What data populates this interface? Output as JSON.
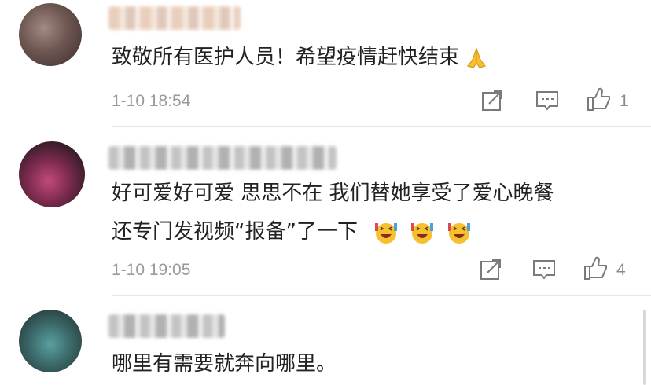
{
  "comments": [
    {
      "text": "致敬所有医护人员！希望疫情赶快结束",
      "time": "1-10 18:54",
      "likes": "1"
    },
    {
      "text_line1": "好可爱好可爱 思思不在 我们替她享受了爱心晚餐",
      "text_line2": "还专门发视频“报备”了一下",
      "time": "1-10 19:05",
      "likes": "4"
    },
    {
      "text": "哪里有需要就奔向哪里。"
    }
  ],
  "icons": {
    "share": "share-icon",
    "comment": "comment-icon",
    "like": "thumbs-up-icon",
    "pray": "praying-hands-emoji",
    "laugh": "laughing-emoji"
  },
  "colors": {
    "text": "#222222",
    "meta": "#9a9a9a",
    "divider": "#e6e6e6",
    "emoji": "#f6c12f"
  }
}
